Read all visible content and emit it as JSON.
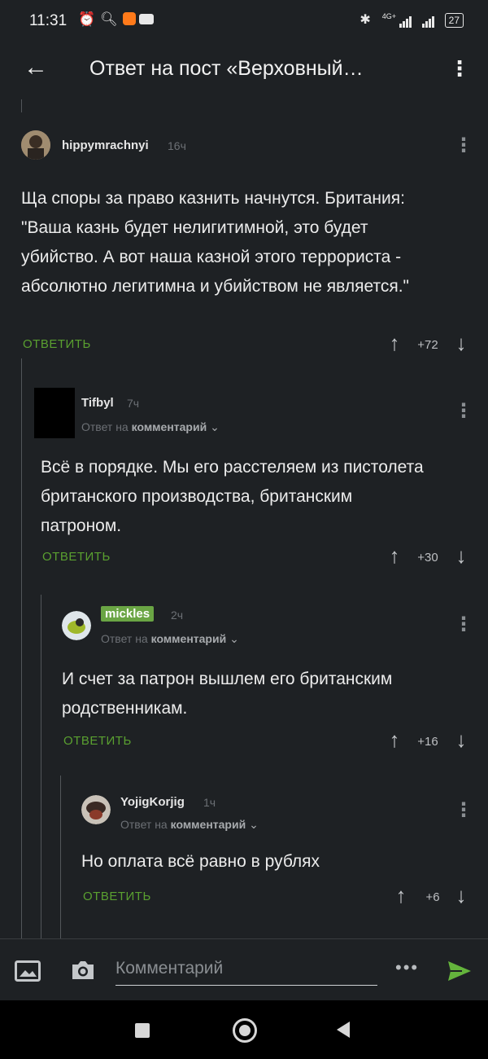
{
  "status_bar": {
    "time": "11:31",
    "network": "4G+",
    "battery": "27",
    "icons": [
      "alarm-icon",
      "search-icon",
      "app-icon",
      "youtube-icon",
      "bluetooth-icon",
      "signal-icon",
      "signal-icon",
      "battery-icon"
    ]
  },
  "app_bar": {
    "title": "Ответ на пост «Верховный…",
    "back_icon": "arrow-left-icon",
    "menu_icon": "more-vertical-icon"
  },
  "comments": [
    {
      "author": "hippymrachnyi",
      "time": "16ч",
      "text": "Ща споры за право казнить начнутся. Британия: \"Ваша казнь будет нелигитимной, это будет убийство. А вот наша казной этого террориста - абсолютно легитимна и убийством не является.\"",
      "reply_label": "ОТВЕТИТЬ",
      "rating": "+72"
    },
    {
      "author": "Tifbyl",
      "time": "7ч",
      "reply_to_prefix": "Ответ на",
      "reply_to_target": "комментарий",
      "text": "Всё в порядке. Мы его расстеляем из пистолета британского производства, британским патроном.",
      "reply_label": "ОТВЕТИТЬ",
      "rating": "+30"
    },
    {
      "author": "mickles",
      "time": "2ч",
      "reply_to_prefix": "Ответ на",
      "reply_to_target": "комментарий",
      "text": "И счет за патрон вышлем его британским родственникам.",
      "reply_label": "ОТВЕТИТЬ",
      "rating": "+16"
    },
    {
      "author": "YojigKorjig",
      "time": "1ч",
      "reply_to_prefix": "Ответ на",
      "reply_to_target": "комментарий",
      "text": "Но оплата всё равно в рублях",
      "reply_label": "ОТВЕТИТЬ",
      "rating": "+6"
    }
  ],
  "composer": {
    "placeholder": "Комментарий",
    "more": "•••"
  },
  "colors": {
    "background": "#1e2124",
    "accent_green": "#5aa030",
    "badge_green": "#6aa544",
    "send_green": "#64b43c"
  }
}
